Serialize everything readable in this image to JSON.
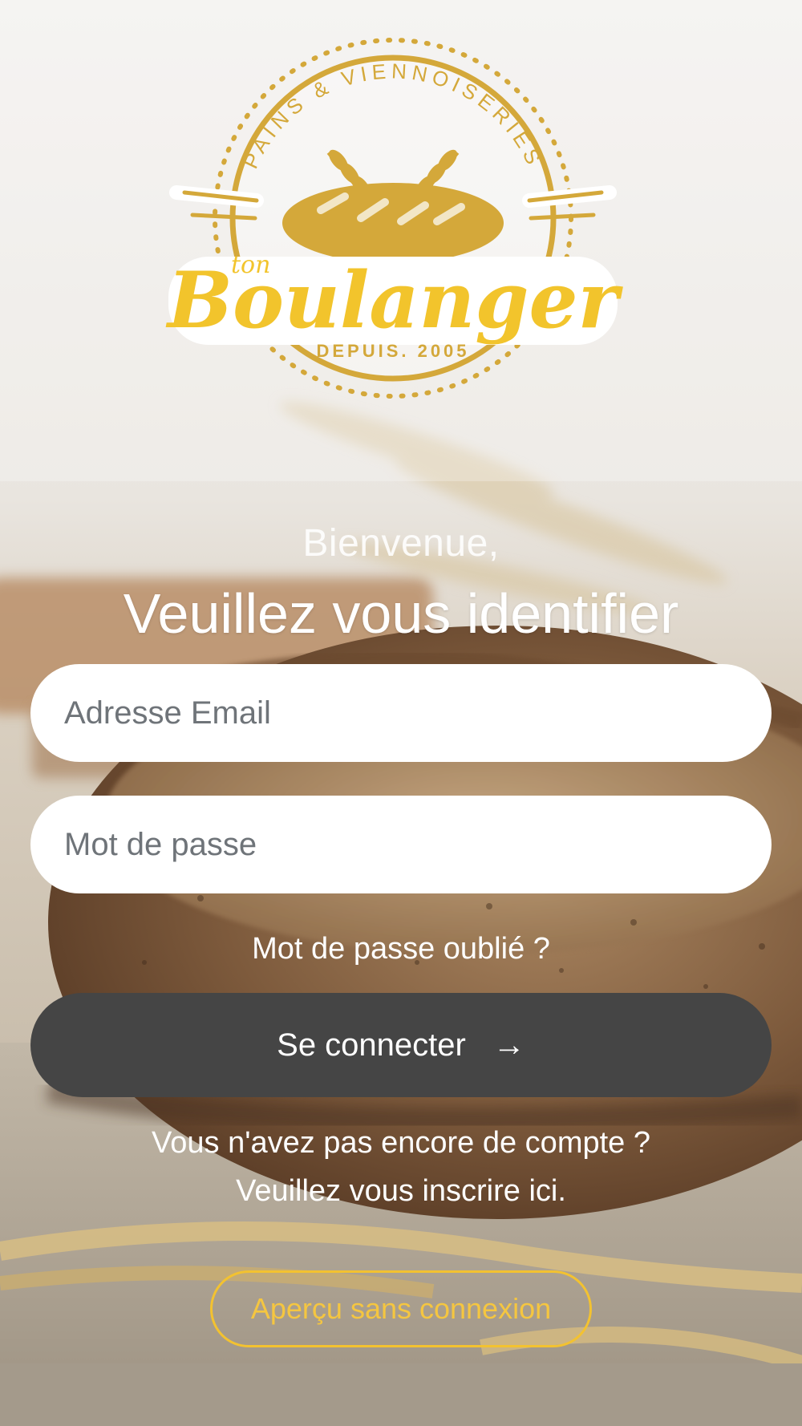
{
  "logo": {
    "arc_text": "PAINS & VIENNOISERIES",
    "small_text": "ton",
    "brand": "Boulanger",
    "since": "DEPUIS. 2005"
  },
  "greeting": {
    "welcome": "Bienvenue,",
    "instruction": "Veuillez vous identifier"
  },
  "form": {
    "email_placeholder": "Adresse Email",
    "password_placeholder": "Mot de passe",
    "forgot_password": "Mot de passe oublié ?",
    "login_label": "Se connecter",
    "login_arrow": "→"
  },
  "signup": {
    "question": "Vous n'avez pas encore de compte ?",
    "link": "Veuillez vous inscrire ici."
  },
  "preview": {
    "label": "Aperçu sans connexion"
  },
  "colors": {
    "accent_gold": "#f3c230",
    "logo_gold": "#d4a83a",
    "button_dark": "#454545"
  }
}
